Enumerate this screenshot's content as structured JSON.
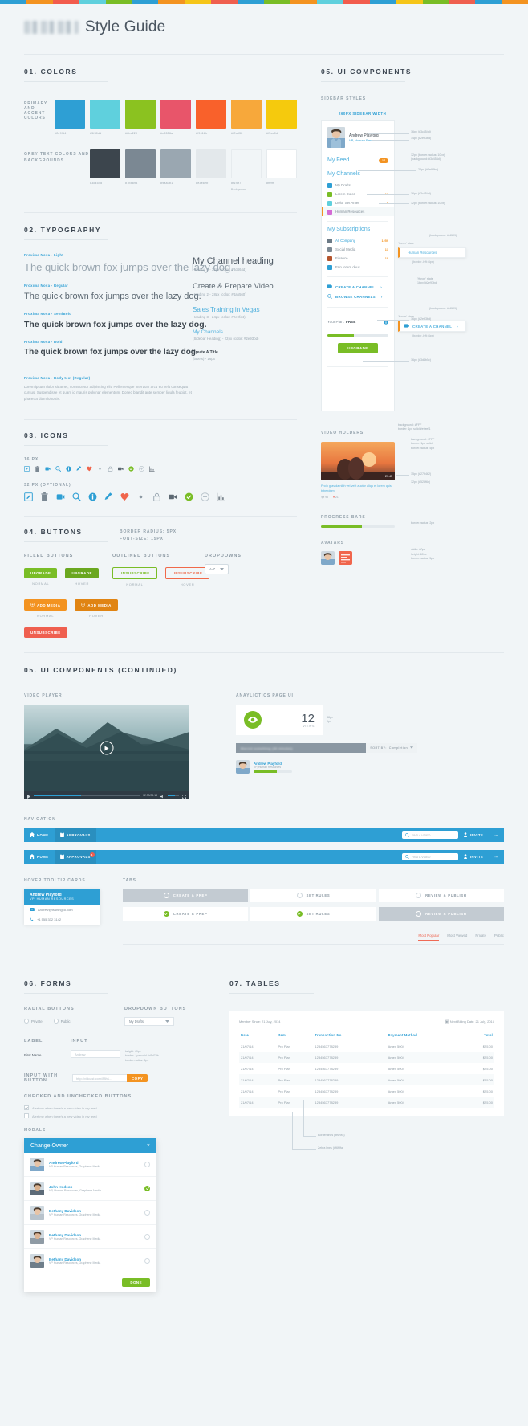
{
  "topstrip_colors": [
    "#2e9fd4",
    "#f39321",
    "#f25c4d",
    "#5fd0dd",
    "#79bd26",
    "#2e9fd4",
    "#f39321",
    "#f5c518",
    "#ef5f4f",
    "#2e9fd4",
    "#79bd26",
    "#f39321",
    "#5fd0dd",
    "#f25c4d",
    "#2e9fd4",
    "#f5c518",
    "#79bd26",
    "#ef5f4f",
    "#2e9fd4",
    "#f39321"
  ],
  "header": {
    "title": "Style Guide",
    "logo_name": "brand-logo-blurred"
  },
  "sections": {
    "colors": "01. COLORS",
    "typography": "02. TYPOGRAPHY",
    "icons": "03. ICONS",
    "buttons": "04. BUTTONS",
    "ui_components": "05. UI COMPONENTS",
    "ui_components_cont": "05. UI COMPONENTS (CONTINUED)",
    "forms": "06. FORMS",
    "tables": "07. TABLES"
  },
  "colors": {
    "primary_label": "PRIMARY AND ACCENT COLORS",
    "grey_label": "GREY TEXT COLORS AND BACKGROUNDS",
    "primary": [
      {
        "hex": "#2e9fd4",
        "name": "#2e9fd4"
      },
      {
        "hex": "#5fd0dd",
        "name": "#5fd0dd"
      },
      {
        "hex": "#8bc220",
        "name": "#8bc220"
      },
      {
        "hex": "#e8556a",
        "name": "#e8556a"
      },
      {
        "hex": "#f9612b",
        "name": "#f9612b"
      },
      {
        "hex": "#f7a83b",
        "name": "#f7a83b"
      },
      {
        "hex": "#f5ca0d",
        "name": "#f5ca0d"
      }
    ],
    "grey": [
      {
        "hex": "#3c454d",
        "name": "#3c454d"
      },
      {
        "hex": "#7b8893",
        "name": "#7b8893"
      },
      {
        "hex": "#9aa7b1",
        "name": "#9aa7b1"
      },
      {
        "hex": "#e3e8eb",
        "name": "#e3e8eb"
      },
      {
        "hex": "#f1f5f7",
        "name": "#f1f5f7",
        "sub": "Background"
      },
      {
        "hex": "#ffffff",
        "name": "#ffffff"
      }
    ]
  },
  "typography": {
    "samples": [
      {
        "tag": "Proxima Nova - Light",
        "text": "The quick brown fox jumps over the lazy dog.",
        "size": "13px",
        "weight": "300",
        "color": "#9aa7b1"
      },
      {
        "tag": "Proxima Nova - Regular",
        "text": "The quick brown fox jumps over the lazy dog.",
        "size": "11px",
        "weight": "400",
        "color": "#5c6872"
      },
      {
        "tag": "Proxima Nova - SemiBold",
        "text": "The quick brown fox jumps over the lazy dog.",
        "size": "10.5px",
        "weight": "600",
        "color": "#3c454d"
      },
      {
        "tag": "Proxima Nova - Bold",
        "text": "The quick brown fox jumps over the lazy dog.",
        "size": "10px",
        "weight": "700",
        "color": "#3c454d"
      }
    ],
    "body_tag": "Proxima Nova - Body text (Regular)",
    "body_text": "Lorem ipsum dolor sit amet, consectetur adipiscing elit. Pellentesque interdum arcu eu velit consequat cursus. Suspendisse et quam id mauris pulvinar elementum. Donec blandit ante semper ligula feugiat, et pharetra diam lobortis.",
    "scale": [
      {
        "text": "My Channel heading",
        "meta": "Heading 1 - 32px (color: #3d464d)",
        "color": "#4a5560",
        "size": "11px",
        "weight": "300"
      },
      {
        "text": "Create & Prepare Video",
        "meta": "Heading 2 - 28px (color: #4a5560)",
        "color": "#5c6872",
        "size": "9.5px",
        "weight": "300"
      },
      {
        "text": "Sales Training in Vegas",
        "meta": "Heading 3 - 24px (color: #2e9fd4)",
        "color": "#4fb0dd",
        "size": "8px",
        "weight": "400"
      },
      {
        "text": "My Channels",
        "meta": "(Sidebar Heading) - 22px (color: #2e93bd)",
        "color": "#4fb0dd",
        "size": "6.5px",
        "weight": "400"
      },
      {
        "text": "Create A Title",
        "meta": "(labels) - 16px",
        "color": "#3c454d",
        "size": "5px",
        "weight": "700"
      }
    ]
  },
  "icons": {
    "row16_label": "16 PX",
    "row32_label": "32 PX (OPTIONAL)",
    "names": [
      "edit-icon",
      "trash-icon",
      "add-video-icon",
      "search-icon",
      "info-icon",
      "pencil-icon",
      "heart-icon",
      "eye-icon",
      "lock-icon",
      "camera-icon",
      "check-circle-icon",
      "plus-circle-icon",
      "chart-icon"
    ]
  },
  "buttons": {
    "spec": "BORDER RADIUS: 5PX\nFONT-SIZE: 15PX",
    "filled_label": "FILLED BUTTONS",
    "outlined_label": "OUTLINED BUTTONS",
    "dropdowns_label": "DROPDOWNS",
    "state_normal": "NORMAL",
    "state_hover": "HOVER",
    "upgrade": "UPGRADE",
    "unsubscribe_out": "UNSUBSCRIBE",
    "unsubscribe_filled": "UNSUBSCRIBE",
    "add_media": "ADD MEDIA",
    "dropdown_value": "A-Z"
  },
  "sidebar": {
    "styles_label": "SIDEBAR STYLES",
    "width_note": "260PX SIDEBAR WIDTH",
    "user": {
      "name": "Andrew Playford",
      "role": "VP, Human Resources"
    },
    "feed": {
      "label": "My Feed",
      "count": "17"
    },
    "channels_heading": "My Channels",
    "channels": [
      {
        "label": "My Drafts",
        "color": "#2e9fd4",
        "count": ""
      },
      {
        "label": "Lorem Dolor",
        "color": "#79bd26",
        "count": "13"
      },
      {
        "label": "Dolor Set Amet",
        "color": "#5fd0dd",
        "count": "5"
      },
      {
        "label": "Human Resources",
        "color": "#d46bd4",
        "count": "",
        "active": true
      }
    ],
    "subs_heading": "My Subscriptions",
    "subscriptions": [
      {
        "label": "All Company",
        "count": "1259"
      },
      {
        "label": "Social Media",
        "count": "13"
      },
      {
        "label": "Finance",
        "count": "10"
      },
      {
        "label": "Erin lorem deus",
        "count": ""
      }
    ],
    "actions": [
      {
        "label": "CREATE A CHANNEL"
      },
      {
        "label": "BROWSE CHANNELS"
      }
    ],
    "plan_label": "Your Plan:",
    "plan_value": "FREE",
    "plan_progress": 44,
    "upgrade_label": "UPGRADE",
    "hover_label": "Human Resources",
    "hover_action": "CREATE A CHANNEL",
    "callouts": {
      "name_size": "16px (#3c454d)",
      "role_size": "14px (#2e93bd)",
      "feed_badge": "12px (border-radius: 10px)\n(background: #3c454d)",
      "channels_heading": "22px (#2e93bd)",
      "channel_item": "16px (#3c454d)",
      "channel_count": "12px (border-radius: 10px)",
      "hover_state1": "'Hover' state",
      "hover_bg": "(background: #f4f8f9)",
      "border_left1": "(border-left: 4px)",
      "sub_hover": "'Hover' state\n16px (#2e93bd)",
      "action_size": "16px (#2e93bd)",
      "hover_state2": "'Hover' state",
      "hover_bg2": "(background: #f4f8f9)",
      "border_left2": "(border-left: 4px)",
      "plan_size": "16px (#3d4b5c)",
      "sidebar_bg": "background: #FFF\nborder: 1px solid #e9eef1"
    }
  },
  "video_holders": {
    "label": "VIDEO HOLDERS",
    "duration": "21:45",
    "title": "Proin gravida nibh vel velit auctor aliqu et lorem quis bibendum",
    "meta_views": "95",
    "meta_likes": "21",
    "callouts": {
      "box": "background: #FFF\nborder: 1px solid\nborder-radius: 5px",
      "thumb": "15px (#2794b2)",
      "title": "12px (#525f6b)"
    }
  },
  "progress": {
    "label": "PROGRESS BARS",
    "value": 55,
    "callout": "border-radius: 2px"
  },
  "avatars": {
    "label": "AVATARS",
    "callout": "width: 60px\nheight: 60px\nborder-radius: 5px"
  },
  "video_player": {
    "label": "VIDEO PLAYER",
    "time": "02:30/05:18",
    "play_name": "play-button"
  },
  "analytics": {
    "label": "ANAYLICTICS PAGE UI",
    "number": "12",
    "views": "VIEWS",
    "callout_48": "48px",
    "callout_9": "9px",
    "bar_text": "Blurred something (30 minutes)",
    "sort_label": "SORT BY:",
    "sort_value": "Completion",
    "user": {
      "name": "Andrew Playford",
      "role": "VP, Human Resources"
    },
    "user_progress": 60
  },
  "navigation": {
    "label": "NAVIGATION",
    "items": [
      {
        "label": "HOME",
        "icon": "home-icon"
      },
      {
        "label": "APPROVALS",
        "icon": "clipboard-icon"
      }
    ],
    "search_placeholder": "FIND A VIDEO",
    "invite_label": "INVITE",
    "more_label": "⋯",
    "badge": "1"
  },
  "tooltip_card": {
    "label": "HOVER TOOLTIP CARDS",
    "name": "Andrew Playford",
    "role": "VP, HUMAN RESOURCES",
    "email": "Andrew@trainingco.com",
    "phone": "+1 555 332 3142"
  },
  "tabs": {
    "label": "TABS",
    "steps": [
      {
        "label": "CREATE & PREP"
      },
      {
        "label": "SET RULES"
      },
      {
        "label": "REVIEW & PUBLISH"
      }
    ],
    "filters": [
      {
        "label": "Most Popular",
        "active": true
      },
      {
        "label": "Most Viewed",
        "active": false
      },
      {
        "label": "Private",
        "active": false
      },
      {
        "label": "Public",
        "active": false
      }
    ]
  },
  "forms": {
    "radial_label": "RADIAL BUTTONS",
    "dropdown_label": "DROPDOWN BUTTONS",
    "radios": [
      {
        "label": "Private"
      },
      {
        "label": "Public"
      }
    ],
    "dropdown_value": "My Drafts",
    "label_col": "LABEL",
    "input_col": "INPUT",
    "first_name": "First Name",
    "input_placeholder": "Andrew",
    "input_note": "height: 40px\nborder: 1px solid #d1d7db\nborder-radius: 5px",
    "input_button_label": "INPUT WITH BUTTON",
    "input_button_placeholder": "http://vidcast.com/88h1...",
    "copy_label": "COPY",
    "checked_label": "CHECKED AND UNCHECKED BUTTONS",
    "check1": "Alert me when there's a new video in my feed",
    "check2": "Alert me when there's a new video in my feed"
  },
  "tables": {
    "member_since": "Member Since: 21 July, 2014",
    "next_billing": "Next Billing Date: 21 July, 2016",
    "headers": [
      "Date",
      "Item",
      "Transaction No.",
      "Payment Method",
      "Total"
    ],
    "rows": [
      [
        "21/07/14",
        "Pro Plan",
        "1234567778239",
        "Amex 5004",
        "$25.00"
      ],
      [
        "21/07/14",
        "Pro Plan",
        "1234567778239",
        "Amex 5004",
        "$25.00"
      ],
      [
        "21/07/14",
        "Pro Plan",
        "1234567778239",
        "Amex 5004",
        "$25.00"
      ],
      [
        "21/07/14",
        "Pro Plan",
        "1234567778239",
        "Amex 5004",
        "$25.00"
      ],
      [
        "21/07/14",
        "Pro Plan",
        "1234567778239",
        "Amex 5004",
        "$25.00"
      ],
      [
        "21/07/14",
        "Pro Plan",
        "1234567778239",
        "Amex 5004",
        "$25.00"
      ]
    ],
    "callout_border": "Border lines (#f6f9fa)",
    "callout_zebra": "Zebra lines (#f6f9fa)"
  },
  "modals": {
    "label": "MODALS",
    "title": "Change Owner",
    "close": "×",
    "done_label": "DONE",
    "rows": [
      {
        "name": "Andrew Playford",
        "meta": "VP Human Resources, Graphene Media",
        "selected": false
      },
      {
        "name": "John Hodson",
        "meta": "VP, Human Resources, Graphene Media",
        "selected": true
      },
      {
        "name": "Bethany Davidson",
        "meta": "VP Human Resources, Graphene Media",
        "selected": false
      },
      {
        "name": "Bethany Davidson",
        "meta": "VP Human Resources, Graphene Media",
        "selected": false
      },
      {
        "name": "Bethany Davidson",
        "meta": "VP Human Resources, Graphene Media",
        "selected": false
      }
    ]
  }
}
